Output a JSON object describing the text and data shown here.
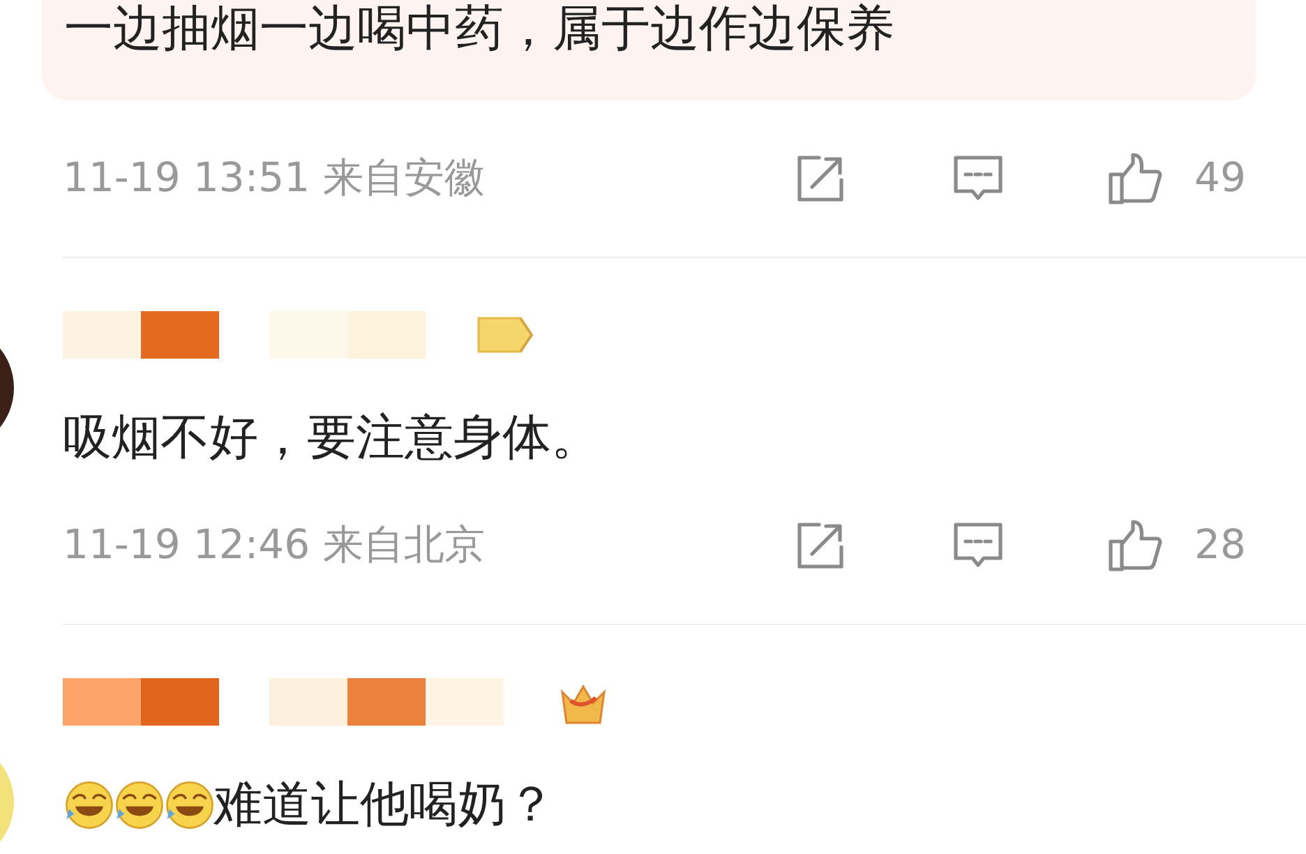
{
  "comments": [
    {
      "kind": "boxed",
      "text": "一边抽烟一边喝中药，属于边作边保养",
      "time": "11-19 13:51",
      "location": "来自安徽",
      "likes": "49"
    },
    {
      "kind": "plain",
      "text": "吸烟不好，要注意身体。",
      "time": "11-19 12:46",
      "location": "来自北京",
      "likes": "28"
    },
    {
      "kind": "emoji",
      "text": "难道让他喝奶？"
    }
  ]
}
